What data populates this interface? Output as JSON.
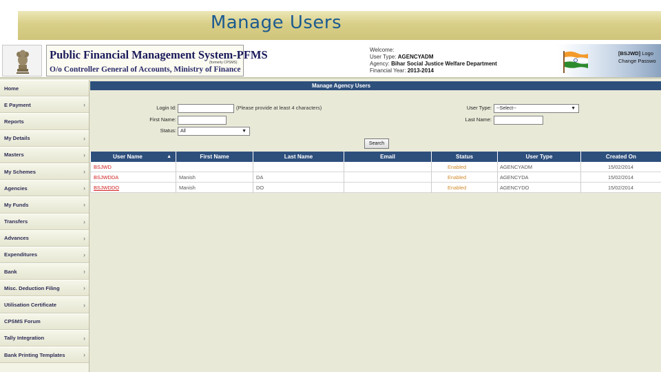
{
  "slide": {
    "title": "Manage Users"
  },
  "header": {
    "logo_title": "Public Financial Management System-PFMS",
    "logo_formerly": "(formerly CPSMS)",
    "logo_subtitle": "O/o Controller General of Accounts, Ministry of Finance",
    "welcome": {
      "greeting": "Welcome:",
      "user_type_label": "User Type:",
      "user_type_value": "AGENCYADM",
      "agency_label": "Agency:",
      "agency_value": "Bihar Social Justice Welfare Department",
      "fy_label": "Financial Year:",
      "fy_value": "2013-2014"
    },
    "user_code": "[BSJWD]",
    "logout_label": "Logo",
    "change_password_label": "Change Passwo"
  },
  "sidebar": {
    "items": [
      {
        "label": "Home",
        "arrow": false
      },
      {
        "label": "E Payment",
        "arrow": true
      },
      {
        "label": "Reports",
        "arrow": false
      },
      {
        "label": "My Details",
        "arrow": true
      },
      {
        "label": "Masters",
        "arrow": true
      },
      {
        "label": "My Schemes",
        "arrow": true
      },
      {
        "label": "Agencies",
        "arrow": true
      },
      {
        "label": "My Funds",
        "arrow": true
      },
      {
        "label": "Transfers",
        "arrow": true
      },
      {
        "label": "Advances",
        "arrow": true
      },
      {
        "label": "Expenditures",
        "arrow": true
      },
      {
        "label": "Bank",
        "arrow": true
      },
      {
        "label": "Misc. Deduction Filing",
        "arrow": true
      },
      {
        "label": "Utilisation Certificate",
        "arrow": true
      },
      {
        "label": "CPSMS Forum",
        "arrow": false
      },
      {
        "label": "Tally Integration",
        "arrow": true
      },
      {
        "label": "Bank Printing Templates",
        "arrow": true
      }
    ],
    "arrow_glyph": "›"
  },
  "form": {
    "panel_title": "Manage Agency Users",
    "login_id_label": "Login Id:",
    "login_id_value": "",
    "login_id_hint": "(Please provide at least 4 characters)",
    "first_name_label": "First Name:",
    "first_name_value": "",
    "status_label": "Status:",
    "status_value": "All",
    "user_type_label": "User Type:",
    "user_type_value": "--Select--",
    "last_name_label": "Last Name:",
    "last_name_value": "",
    "search_label": "Search",
    "caret_glyph": "▼"
  },
  "table": {
    "sort_glyph": "▲",
    "columns": [
      "User Name",
      "First Name",
      "Last Name",
      "Email",
      "Status",
      "User Type",
      "Created On"
    ],
    "rows": [
      [
        "BSJWD",
        "",
        "",
        "",
        "Enabled",
        "AGENCYADM",
        "15/02/2014"
      ],
      [
        "BSJWDDA",
        "Manish",
        "DA",
        "",
        "Enabled",
        "AGENCYDA",
        "15/02/2014"
      ],
      [
        "BSJWDDO",
        "Manish",
        "DO",
        "",
        "Enabled",
        "AGENCYDO",
        "15/02/2014"
      ]
    ]
  },
  "colors": {
    "panel_header": "#2d4f7c",
    "title_text": "#1c5a90",
    "user_link": "#d02020",
    "status_enabled": "#d08a2a"
  }
}
